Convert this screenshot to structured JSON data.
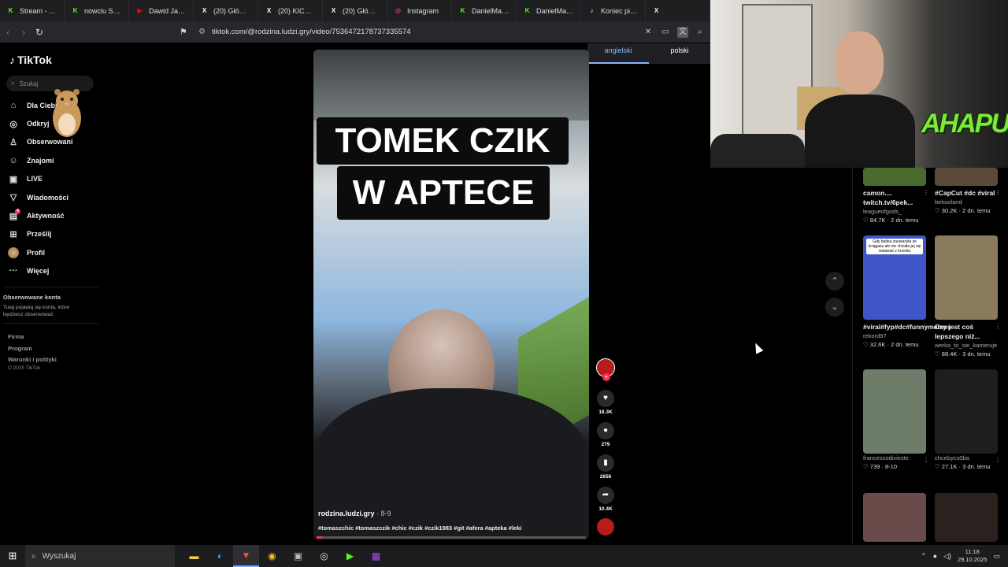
{
  "browser": {
    "tabs": [
      {
        "title": "Stream - Kick D",
        "icon": "kick-icon",
        "color": "#53fc18",
        "glyph": "K"
      },
      {
        "title": "nowciu Stream",
        "icon": "kick-icon",
        "color": "#53fc18",
        "glyph": "K"
      },
      {
        "title": "Dawid Jasper II",
        "icon": "youtube-icon",
        "color": "#ff0000",
        "glyph": "▶"
      },
      {
        "title": "(20) Główna / X",
        "icon": "x-icon",
        "color": "#000000",
        "glyph": "X"
      },
      {
        "title": "(20) KICK (@Ki",
        "icon": "x-icon",
        "color": "#000000",
        "glyph": "X"
      },
      {
        "title": "(20) Główna / X",
        "icon": "x-icon",
        "color": "#000000",
        "glyph": "X"
      },
      {
        "title": "Instagram",
        "icon": "instagram-icon",
        "color": "#d62976",
        "glyph": "◎"
      },
      {
        "title": "DanielMagical",
        "icon": "kick-icon",
        "color": "#53fc18",
        "glyph": "K"
      },
      {
        "title": "DanielMagical",
        "icon": "kick-icon",
        "color": "#53fc18",
        "glyph": "K"
      },
      {
        "title": "Koniec pienięd",
        "icon": "tiktok-icon",
        "color": "#000000",
        "glyph": "♪"
      },
      {
        "title": "",
        "icon": "x-icon",
        "color": "#000000",
        "glyph": "X"
      }
    ],
    "url": "tiktok.com/@rodzina.ludzi.gry/video/7536472178737335574",
    "translate": {
      "options": [
        "angielski",
        "polski"
      ],
      "selected": "angielski"
    }
  },
  "tiktok": {
    "logo": "TikTok",
    "search_placeholder": "Szukaj",
    "nav": [
      {
        "label": "Dla Ciebie",
        "icon": "home-icon",
        "glyph": "⌂"
      },
      {
        "label": "Odkryj",
        "icon": "compass-icon",
        "glyph": "◎"
      },
      {
        "label": "Obserwowani",
        "icon": "user-icon",
        "glyph": "♙"
      },
      {
        "label": "Znajomi",
        "icon": "friends-icon",
        "glyph": "☺"
      },
      {
        "label": "LIVE",
        "icon": "live-icon",
        "glyph": "▣"
      },
      {
        "label": "Wiadomości",
        "icon": "inbox-icon",
        "glyph": "▽"
      },
      {
        "label": "Aktywność",
        "icon": "activity-icon",
        "glyph": "▤",
        "badge": "4"
      },
      {
        "label": "Prześlij",
        "icon": "upload-icon",
        "glyph": "⊞"
      },
      {
        "label": "Profil",
        "icon": "avatar",
        "glyph": ""
      },
      {
        "label": "Więcej",
        "icon": "more-icon",
        "glyph": "···"
      }
    ],
    "following_title": "Obserwowane konta",
    "following_text": "Tutaj pojawią się konta, które będziesz obserwować",
    "footer": [
      "Firma",
      "Program",
      "Warunki i polityki"
    ],
    "copyright": "© 2025 TikTok"
  },
  "video": {
    "caption_line1": "TOMEK CZIK",
    "caption_line2": "W APTECE",
    "author": "rodzina.ludzi.gry",
    "date": "· 8-9",
    "hashtags": "#tomaszchic #tomaszczik #chic #czik #czik1983 #git #afera #apteka #leki",
    "progress": 0.02,
    "actions": {
      "likes": "18.3K",
      "comments": "279",
      "saves": "2656",
      "shares": "10.4K"
    }
  },
  "webcam": {
    "brand": "AHAPULCO"
  },
  "recommended": [
    {
      "title": "camon.... twitch.tv/6pek...",
      "author": "leagueofgods_",
      "meta": "♡ 84.7K · 2 dn. temu",
      "thumb": "#4a6b2e"
    },
    {
      "title": "#CapCut #dc #viral",
      "author": "bekooland",
      "meta": "♡ 30.2K · 2 dn. temu",
      "thumb": "#5a4a3a"
    },
    {
      "title": "#viral#fyp#dc#funnymemes",
      "author": "rekord97",
      "meta": "♡ 32.6K · 2 dn. temu",
      "thumb": "#3f56c9",
      "overlay": "Gdy babka zauważyła że ściągasz ale nie chciała jej się wstawać z krzesła"
    },
    {
      "title": "Czy jest coś lepszego niż...",
      "author": "werka_to_sie_kameruje",
      "meta": "♡ 88.4K · 3 dn. temu",
      "thumb": "#8a7a5c"
    },
    {
      "title": "",
      "author": "francescodivieste",
      "meta": "♡ 739 · 8-10",
      "thumb": "#6e7c6a"
    },
    {
      "title": "",
      "author": "chcebycs0ba",
      "meta": "♡ 27.1K · 3 dn. temu",
      "thumb": "#1e1e20"
    },
    {
      "title": "",
      "author": "",
      "meta": "",
      "thumb": "#6b4a4a"
    },
    {
      "title": "",
      "author": "",
      "meta": "",
      "thumb": "#2b2220"
    }
  ],
  "taskbar": {
    "search_label": "Wyszukaj",
    "time": "11:18",
    "date": "29.10.2025"
  }
}
